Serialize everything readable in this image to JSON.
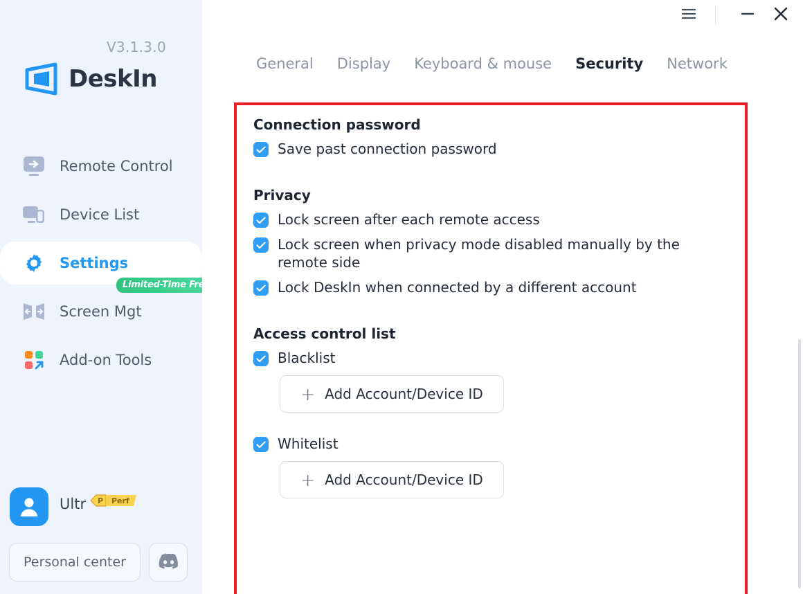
{
  "sidebar": {
    "version": "V3.1.3.0",
    "brand_name": "DeskIn",
    "brand_logo_icon": "deskin-logo-icon",
    "items": [
      {
        "label": "Remote Control",
        "icon": "monitor-arrow-icon",
        "active": false
      },
      {
        "label": "Device List",
        "icon": "devices-icon",
        "active": false
      },
      {
        "label": "Settings",
        "icon": "gear-icon",
        "active": true
      },
      {
        "label": "Screen Mgt",
        "icon": "screen-expand-icon",
        "active": false,
        "badge": "Limited-Time Free"
      },
      {
        "label": "Add-on Tools",
        "icon": "grid-arrow-icon",
        "active": false
      }
    ],
    "user": {
      "name": "Ultr",
      "avatar_icon": "user-avatar-icon",
      "badge_letter": "P",
      "badge_text": "Perf"
    },
    "personal_center_label": "Personal center",
    "discord_icon": "discord-icon"
  },
  "titlebar": {
    "menu_icon": "hamburger-menu-icon",
    "minimize_icon": "minimize-icon",
    "close_icon": "close-icon"
  },
  "tabs": [
    {
      "label": "General",
      "active": false
    },
    {
      "label": "Display",
      "active": false
    },
    {
      "label": "Keyboard & mouse",
      "active": false
    },
    {
      "label": "Security",
      "active": true
    },
    {
      "label": "Network",
      "active": false
    }
  ],
  "security": {
    "connection_password": {
      "title": "Connection password",
      "options": [
        {
          "label": "Save past connection password",
          "checked": true
        }
      ]
    },
    "privacy": {
      "title": "Privacy",
      "options": [
        {
          "label": "Lock screen after each remote access",
          "checked": true
        },
        {
          "label": "Lock screen when privacy mode disabled manually by the remote side",
          "checked": true
        },
        {
          "label": "Lock DeskIn when connected by a different account",
          "checked": true
        }
      ]
    },
    "access_control_list": {
      "title": "Access control list",
      "entries": [
        {
          "label": "Blacklist",
          "checked": true,
          "add_button_label": "Add Account/Device ID"
        },
        {
          "label": "Whitelist",
          "checked": true,
          "add_button_label": "Add Account/Device ID"
        }
      ]
    }
  },
  "colors": {
    "accent": "#2196f3",
    "checkbox": "#2f9df4",
    "sidebar_bg": "#eef3fd",
    "highlight_box": "#ec1c24",
    "badge_green": "#2ec27e",
    "badge_gold": "#f5c842"
  }
}
